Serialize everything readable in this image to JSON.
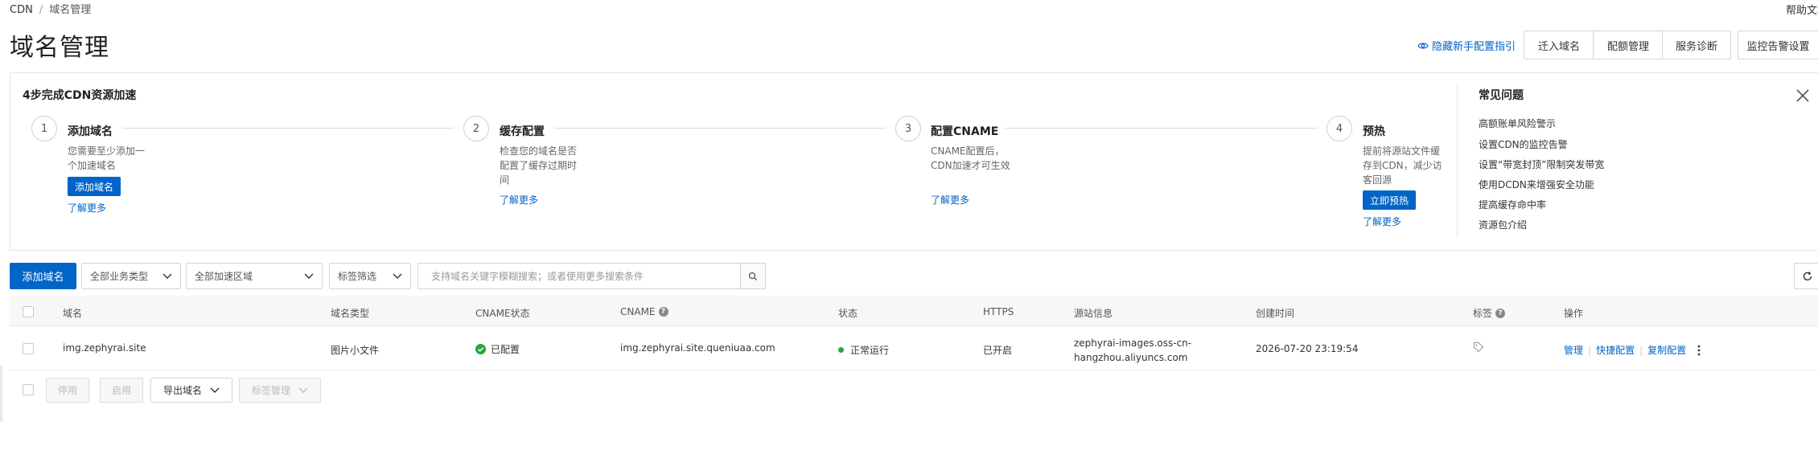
{
  "breadcrumb": {
    "root": "CDN",
    "separator": "/",
    "current": "域名管理"
  },
  "help_doc": "帮助文档",
  "page_title": "域名管理",
  "header": {
    "guide_link": "隐藏新手配置指引",
    "buttons": [
      "迁入域名",
      "配额管理",
      "服务诊断",
      "监控告警设置"
    ]
  },
  "guide": {
    "title": "4步完成CDN资源加速",
    "steps": [
      {
        "num": "1",
        "title": "添加域名",
        "desc": "您需要至少添加一个加速域名",
        "button": "添加域名",
        "more": "了解更多"
      },
      {
        "num": "2",
        "title": "缓存配置",
        "desc": "检查您的域名是否配置了缓存过期时间",
        "more": "了解更多"
      },
      {
        "num": "3",
        "title": "配置CNAME",
        "desc": "CNAME配置后，CDN加速才可生效",
        "more": "了解更多"
      },
      {
        "num": "4",
        "title": "预热",
        "desc": "提前将源站文件缓存到CDN，减少访客回源",
        "button": "立即预热",
        "more": "了解更多"
      }
    ],
    "faq_title": "常见问题",
    "faq": [
      "高额账单风险警示",
      "设置CDN的监控告警",
      "设置“带宽封顶”限制突发带宽",
      "使用DCDN来增强安全功能",
      "提高缓存命中率",
      "资源包介绍"
    ]
  },
  "toolbar": {
    "add_domain": "添加域名",
    "business_type": "全部业务类型",
    "region": "全部加速区域",
    "tag_filter": "标签筛选",
    "search_placeholder": "支持域名关键字模糊搜索；或者使用更多搜索条件"
  },
  "table": {
    "columns": [
      "域名",
      "域名类型",
      "CNAME状态",
      "CNAME",
      "状态",
      "HTTPS",
      "源站信息",
      "创建时间",
      "标签",
      "操作"
    ],
    "rows": [
      {
        "domain": "img.zephyrai.site",
        "type": "图片小文件",
        "cname_status": "已配置",
        "cname": "img.zephyrai.site.queniuaa.com",
        "status": "正常运行",
        "https": "已开启",
        "origin_line1": "zephyrai-images.oss-cn-",
        "origin_line2": "hangzhou.aliyuncs.com",
        "created": "2026-07-20 23:19:54",
        "ops": [
          "管理",
          "快捷配置",
          "复制配置"
        ]
      }
    ]
  },
  "footer": {
    "disable": "停用",
    "enable": "启用",
    "export": "导出域名",
    "tag_manage": "标签管理"
  },
  "colors": {
    "primary": "#0064c8",
    "success": "#23a93b",
    "status_dot": "#23a93b"
  }
}
